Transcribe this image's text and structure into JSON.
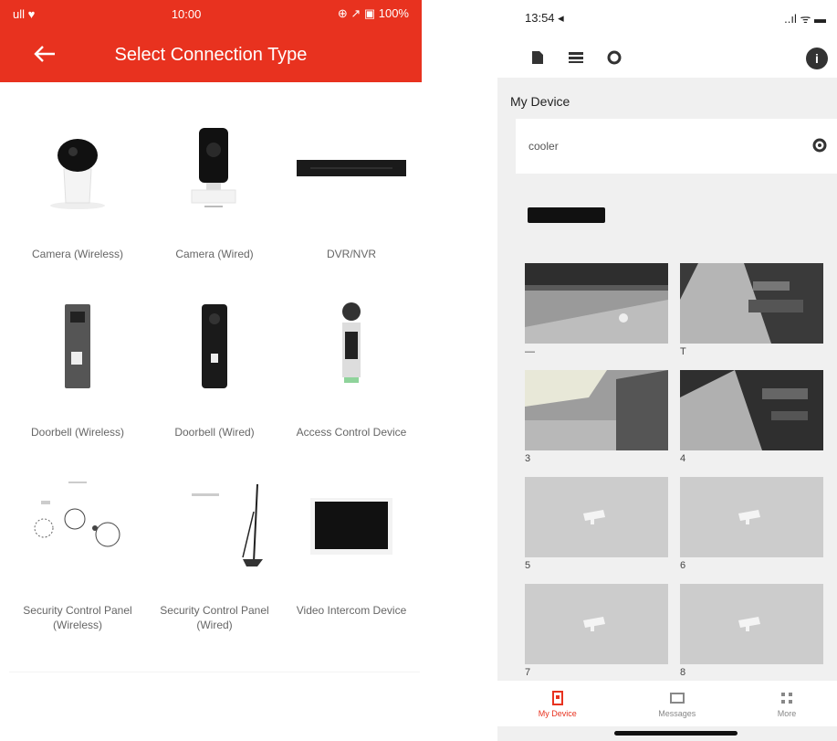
{
  "left": {
    "status": {
      "carrier": "ull ♥",
      "time": "10:00",
      "right": "⊕ ↗ ▣ 100%"
    },
    "header": {
      "title": "Select Connection Type"
    },
    "devices": [
      {
        "label": "Camera (Wireless)"
      },
      {
        "label": "Camera (Wired)"
      },
      {
        "label": "DVR/NVR"
      },
      {
        "label": "Doorbell (Wireless)"
      },
      {
        "label": "Doorbell (Wired)"
      },
      {
        "label": "Access Control Device"
      },
      {
        "label": "Security Control Panel (Wireless)"
      },
      {
        "label": "Security Control Panel (Wired)"
      },
      {
        "label": "Video Intercom Device"
      }
    ]
  },
  "right": {
    "status": {
      "time": "13:54 ◂",
      "right": "..ıl ᯤ ▬"
    },
    "section_title": "My Device",
    "group_name": "cooler",
    "cameras": [
      {
        "caption": "—"
      },
      {
        "caption": "T"
      },
      {
        "caption": "3"
      },
      {
        "caption": "4"
      },
      {
        "caption": "5"
      },
      {
        "caption": "6"
      },
      {
        "caption": "7"
      },
      {
        "caption": "8"
      }
    ],
    "tabs": [
      {
        "label": "My Device",
        "icon": "device-icon"
      },
      {
        "label": "Messages",
        "icon": "message-icon"
      },
      {
        "label": "More",
        "icon": "grid-icon"
      }
    ]
  },
  "colors": {
    "brand": "#e8321f"
  }
}
